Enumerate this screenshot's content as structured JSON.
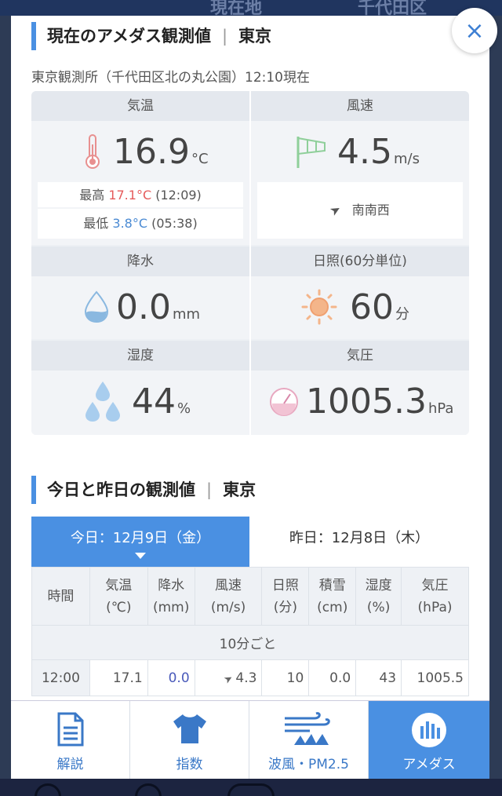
{
  "background": {
    "label_left": "現在地",
    "label_right": "千代田区"
  },
  "colors": {
    "accent": "#4a90e2",
    "max_temp": "#e55a5a",
    "min_temp": "#4a8ad3"
  },
  "close_label": "×",
  "amedas": {
    "title": "現在のアメダス観測値",
    "separator": "|",
    "location": "東京",
    "station": "東京観測所（千代田区北の丸公園）12:10現在",
    "temperature": {
      "label": "気温",
      "value": "16.9",
      "unit": "°C",
      "max_label": "最高",
      "max_value": "17.1°C",
      "max_time": "(12:09)",
      "min_label": "最低",
      "min_value": "3.8°C",
      "min_time": "(05:38)"
    },
    "wind": {
      "label": "風速",
      "value": "4.5",
      "unit": "m/s",
      "direction": "南南西"
    },
    "precipitation": {
      "label": "降水",
      "value": "0.0",
      "unit": "mm"
    },
    "sunshine": {
      "label": "日照(60分単位)",
      "value": "60",
      "unit": "分"
    },
    "humidity": {
      "label": "湿度",
      "value": "44",
      "unit": "%"
    },
    "pressure": {
      "label": "気圧",
      "value": "1005.3",
      "unit": "hPa"
    }
  },
  "observations": {
    "title": "今日と昨日の観測値",
    "separator": "|",
    "location": "東京",
    "tab_today": "今日：12月9日（金）",
    "tab_yesterday": "昨日：12月8日（木）",
    "headers": [
      {
        "l1": "時間",
        "l2": ""
      },
      {
        "l1": "気温",
        "l2": "(℃)"
      },
      {
        "l1": "降水",
        "l2": "(mm)"
      },
      {
        "l1": "風速",
        "l2": "(m/s)"
      },
      {
        "l1": "日照",
        "l2": "(分)"
      },
      {
        "l1": "積雪",
        "l2": "(cm)"
      },
      {
        "l1": "湿度",
        "l2": "(%)"
      },
      {
        "l1": "気圧",
        "l2": "(hPa)"
      }
    ],
    "interval_label": "10分ごと",
    "rows": [
      {
        "time": "12:00",
        "temp": "17.1",
        "precip": "0.0",
        "wind": "4.3",
        "sun": "10",
        "snow": "0.0",
        "humidity": "43",
        "pressure": "1005.5"
      }
    ]
  },
  "nav": [
    {
      "label": "解説",
      "icon": "document-icon"
    },
    {
      "label": "指数",
      "icon": "shirt-icon"
    },
    {
      "label": "波風・PM2.5",
      "icon": "wave-icon"
    },
    {
      "label": "アメダス",
      "icon": "bar-chart-icon"
    }
  ]
}
